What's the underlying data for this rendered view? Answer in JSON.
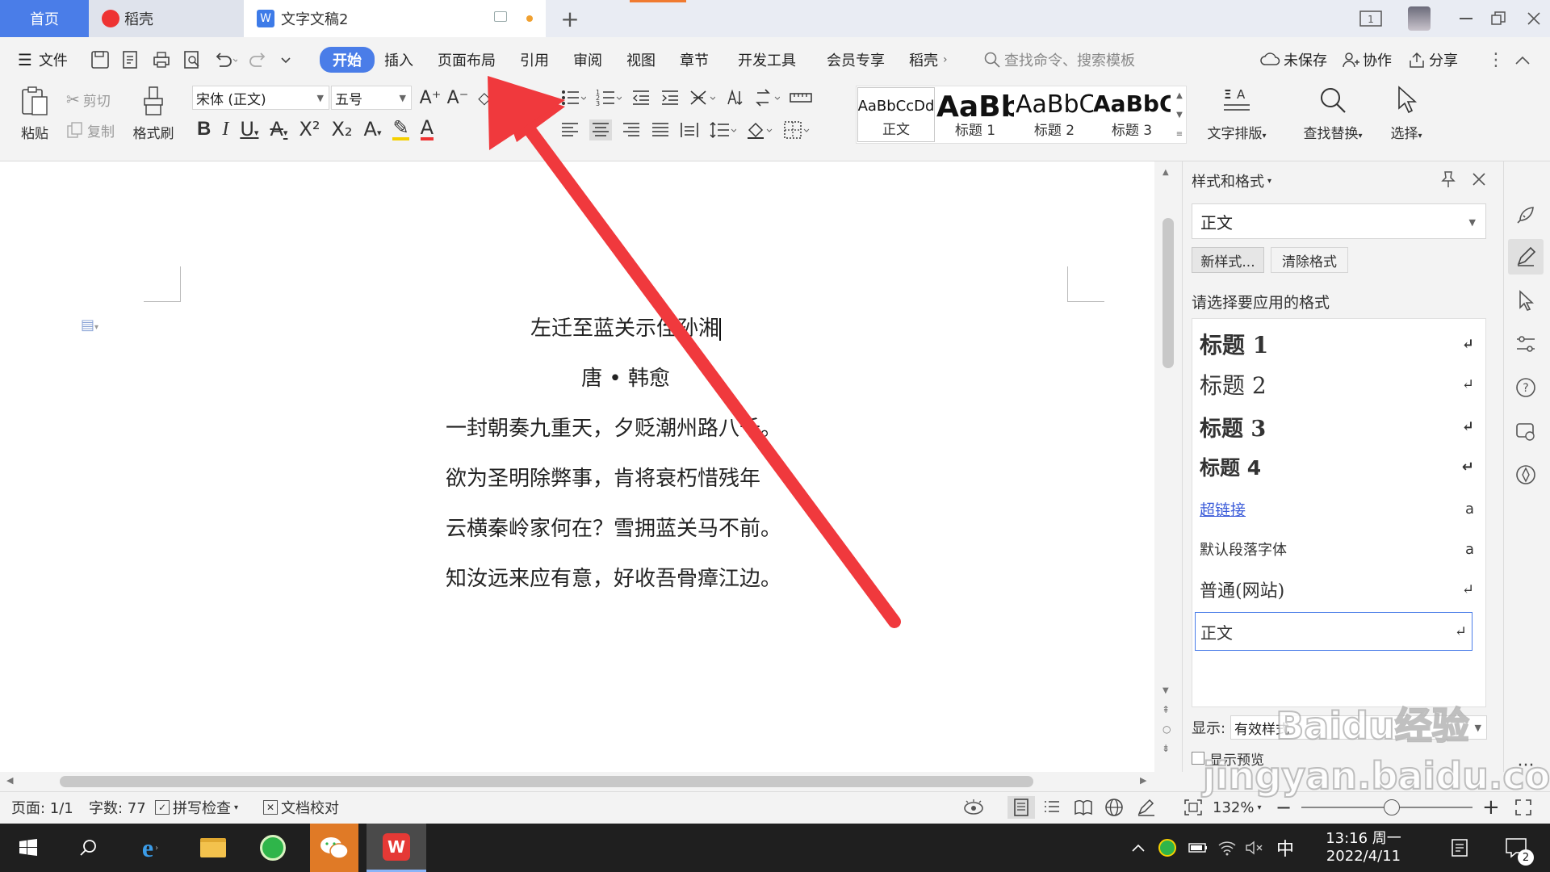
{
  "tabs": {
    "home": "首页",
    "daoke": "稻壳",
    "doc": "文字文稿2"
  },
  "menu": {
    "file": "文件",
    "start": "开始",
    "insert": "插入",
    "layout": "页面布局",
    "reference": "引用",
    "review": "审阅",
    "view": "视图",
    "section": "章节",
    "dev": "开发工具",
    "member": "会员专享",
    "daoke": "稻壳",
    "search_placeholder": "查找命令、搜索模板",
    "unsaved": "未保存",
    "collab": "协作",
    "share": "分享"
  },
  "ribbon": {
    "paste": "粘贴",
    "cut": "剪切",
    "copy": "复制",
    "format_painter": "格式刷",
    "font": "宋体 (正文)",
    "size": "五号",
    "styles": [
      {
        "preview": "AaBbCcDd",
        "name": "正文"
      },
      {
        "preview": "AaBb",
        "name": "标题 1"
      },
      {
        "preview": "AaBbC",
        "name": "标题 2"
      },
      {
        "preview": "AaBbC",
        "name": "标题 3"
      }
    ],
    "text_layout": "文字排版",
    "find_replace": "查找替换",
    "select": "选择"
  },
  "document": {
    "lines": [
      "左迁至蓝关示侄孙湘",
      "唐 • 韩愈",
      "一封朝奏九重天，夕贬潮州路八千。",
      "欲为圣明除弊事，肯将衰朽惜残年",
      "云横秦岭家何在？雪拥蓝关马不前。",
      "知汝远来应有意，好收吾骨瘴江边。"
    ]
  },
  "pane": {
    "title": "样式和格式",
    "current": "正文",
    "new_style": "新样式...",
    "clear_format": "清除格式",
    "prompt": "请选择要应用的格式",
    "items": [
      {
        "label": "标题  1",
        "mark": "↵"
      },
      {
        "label": "标题  2",
        "mark": "↵"
      },
      {
        "label": "标题  3",
        "mark": "↵"
      },
      {
        "label": "标题  4",
        "mark": "↵"
      },
      {
        "label": "超链接",
        "mark": "a"
      },
      {
        "label": "默认段落字体",
        "mark": "a"
      },
      {
        "label": "普通(网站)",
        "mark": "↵"
      },
      {
        "label": "正文",
        "mark": "↵"
      }
    ],
    "show_label": "显示:",
    "show_value": "有效样式",
    "preview_label": "显示预览"
  },
  "status": {
    "page": "页面: 1/1",
    "words": "字数: 77",
    "spell": "拼写检查",
    "proof": "文档校对",
    "zoom": "132%"
  },
  "taskbar": {
    "ime": "中",
    "time": "13:16 周一",
    "date": "2022/4/11",
    "badge": "2"
  },
  "watermark": "Baidu经验 jingyan.baidu.com",
  "colors": {
    "accent": "#4a7de8",
    "arrow": "#f0393d"
  }
}
